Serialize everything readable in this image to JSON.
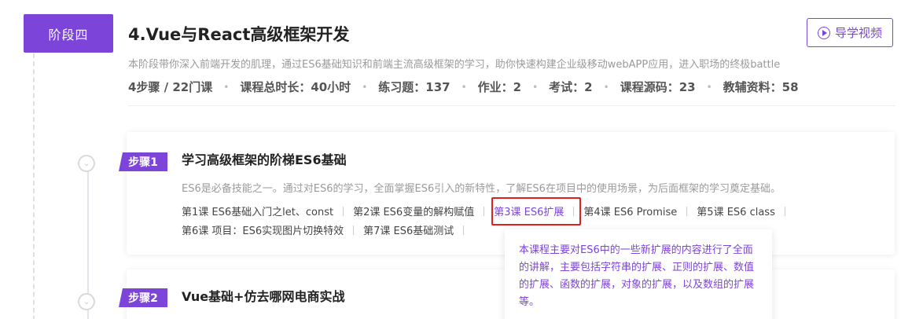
{
  "stage": {
    "badge": "阶段四",
    "title": "4.Vue与React高级框架开发",
    "guide_button": "导学视频",
    "description": "本阶段带你深入前端开发的肌理，通过ES6基础知识和前端主流高级框架的学习，助你快速构建企业级移动webAPP应用，进入职场的终极battle",
    "stats": [
      "4步骤 / 22门课",
      "课程总时长：40小时",
      "练习题：137",
      "作业：2",
      "考试：2",
      "课程源码：23",
      "教辅资料：58"
    ]
  },
  "steps": [
    {
      "tag": "步骤1",
      "title": "学习高级框架的阶梯ES6基础",
      "description": "ES6是必备技能之一。通过对ES6的学习，全面掌握ES6引入的新特性，了解ES6在项目中的使用场景，为后面框架的学习奠定基础。",
      "lessons_row1": [
        "第1课 ES6基础入门之let、const",
        "第2课 ES6变量的解构赋值",
        "第3课 ES6扩展",
        "第4课 ES6 Promise",
        "第5课 ES6 class"
      ],
      "lessons_row2": [
        "第6课 项目：ES6实现图片切换特效",
        "第7课 ES6基础测试"
      ]
    },
    {
      "tag": "步骤2",
      "title": "Vue基础+仿去哪网电商实战"
    }
  ],
  "tooltip": {
    "text": "本课程主要对ES6中的一些新扩展的内容进行了全面的讲解，主要包括字符串的扩展、正则的扩展、数值的扩展、函数的扩展，对象的扩展，以及数组的扩展等。"
  },
  "colors": {
    "accent": "#7c44d9",
    "highlight": "#e0201e"
  }
}
